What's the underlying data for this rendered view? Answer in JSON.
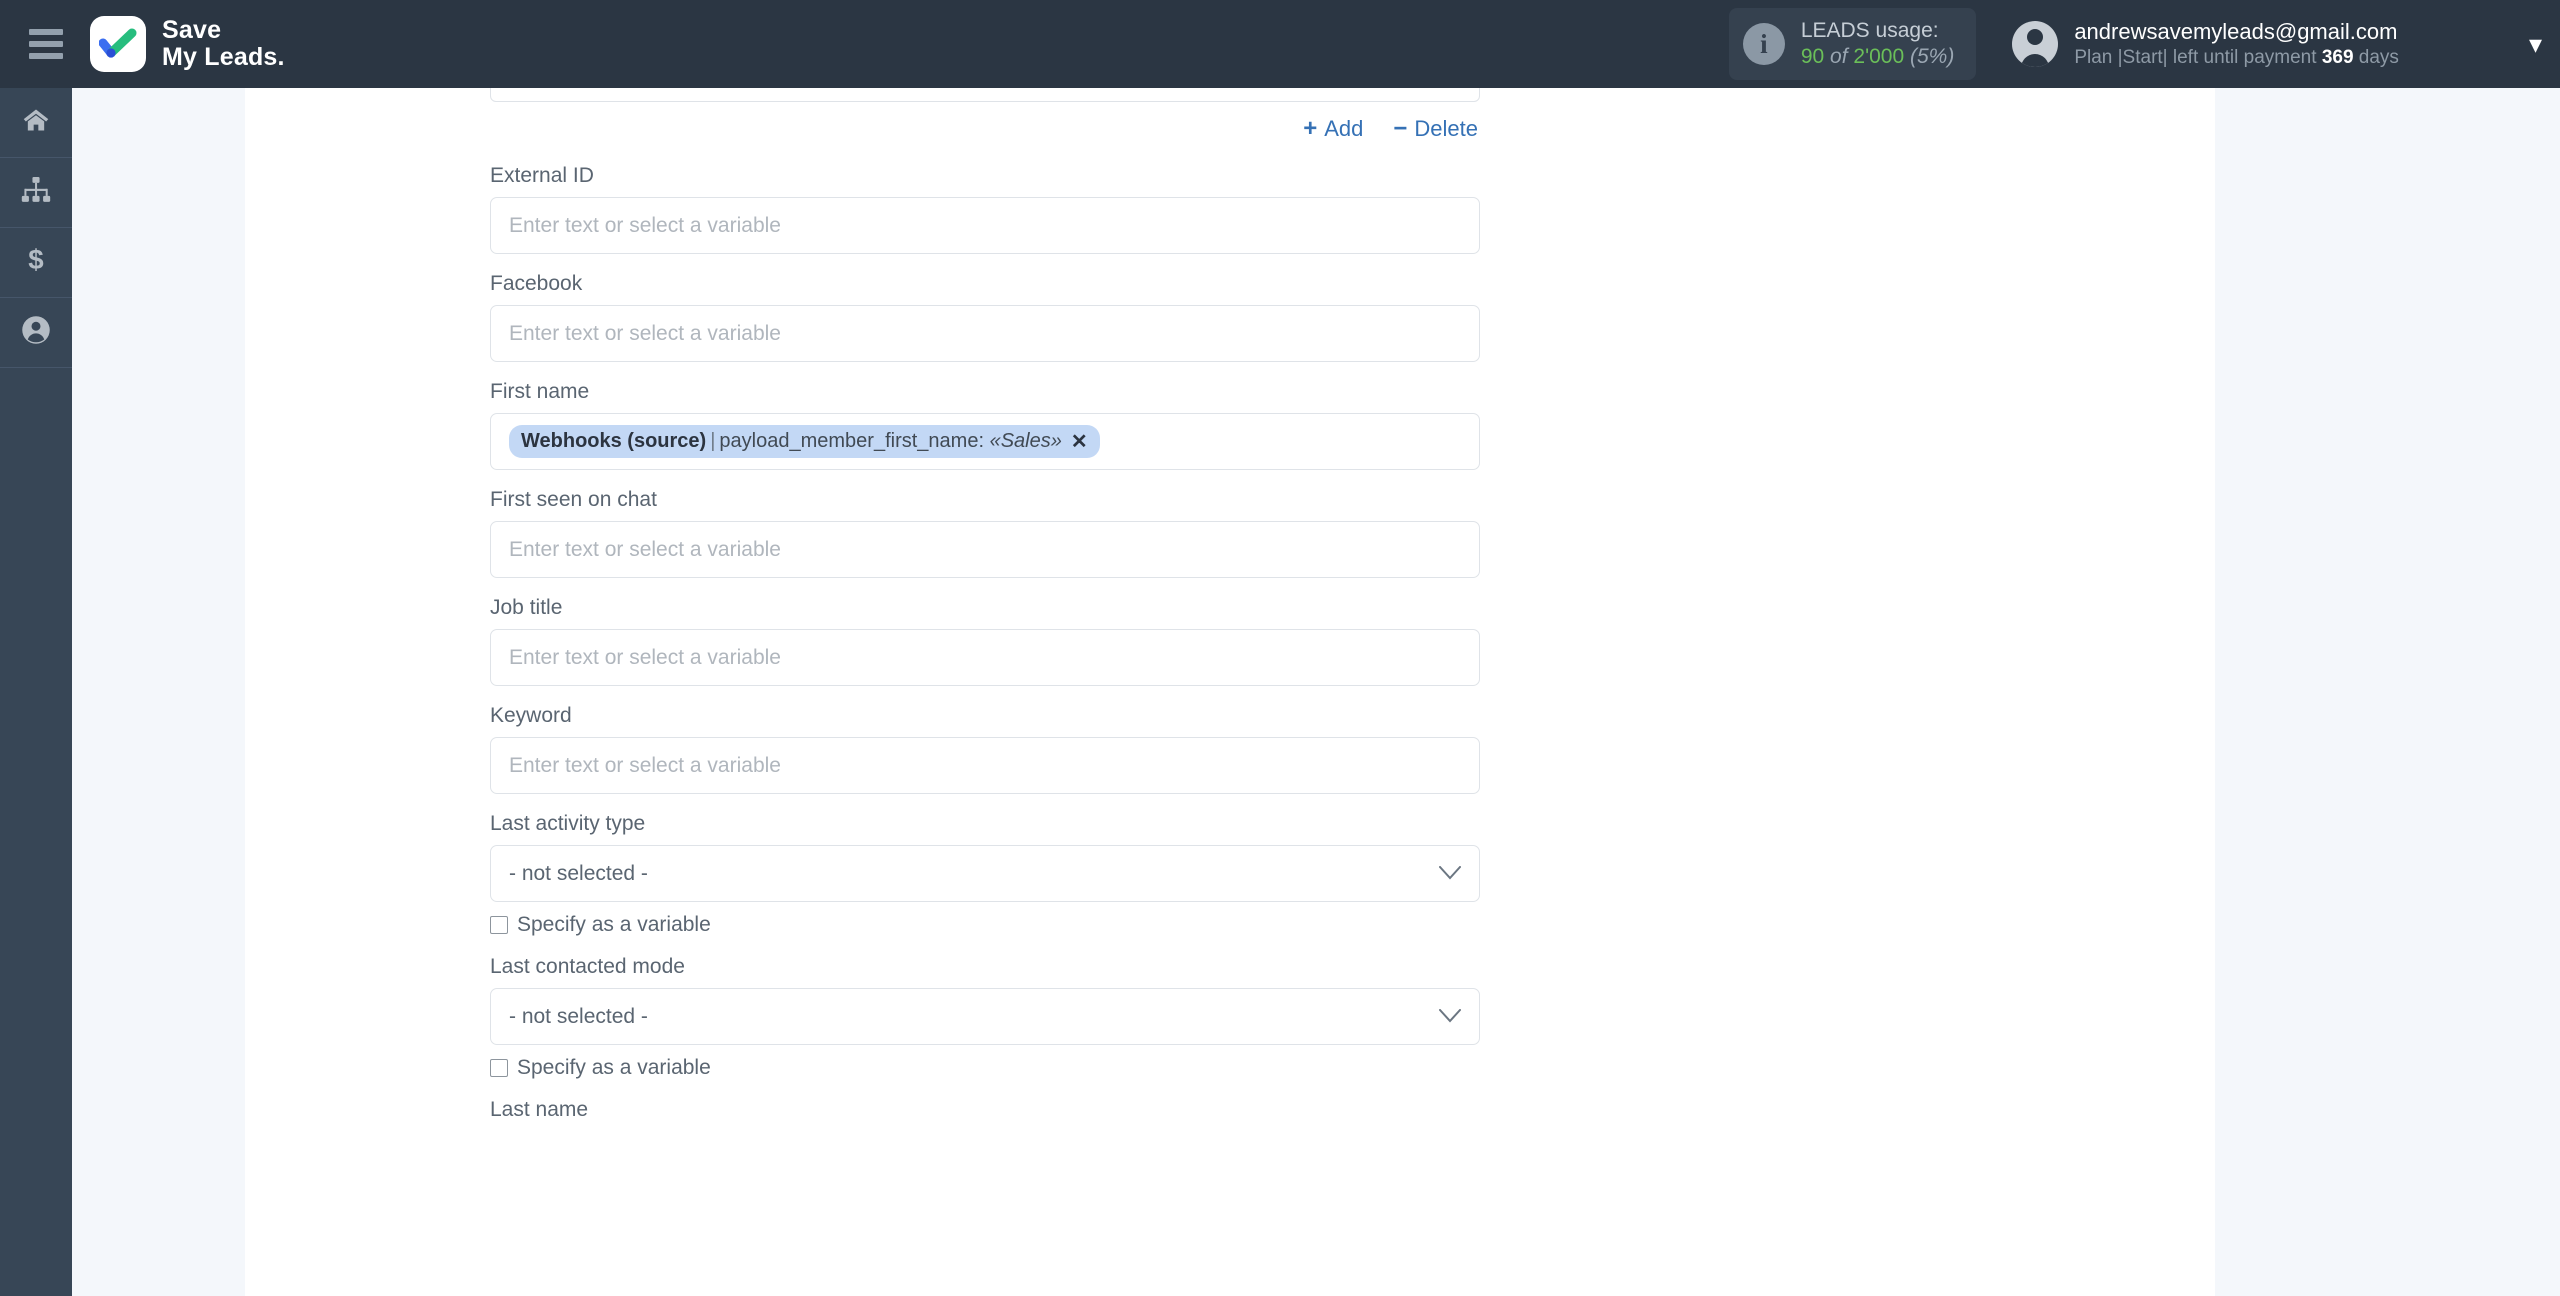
{
  "header": {
    "menu_icon": "hamburger-icon",
    "brand_line1": "Save",
    "brand_line2": "My Leads.",
    "usage": {
      "info_glyph": "i",
      "title": "LEADS usage:",
      "used": "90",
      "of": "of",
      "total": "2'000",
      "percent": "(5%)"
    },
    "account": {
      "email": "andrewsavemyleads@gmail.com",
      "plan_prefix": "Plan |Start| left until payment",
      "days_value": "369",
      "days_suffix": "days",
      "caret": "▾"
    }
  },
  "sidebar": {
    "items": [
      {
        "name": "home",
        "icon": "home-icon"
      },
      {
        "name": "connections",
        "icon": "sitemap-icon"
      },
      {
        "name": "billing",
        "icon": "dollar-icon"
      },
      {
        "name": "account",
        "icon": "user-circle-icon"
      }
    ]
  },
  "toolbar": {
    "add_symbol": "+",
    "add_label": "Add",
    "delete_symbol": "−",
    "delete_label": "Delete"
  },
  "form": {
    "placeholder": "Enter text or select a variable",
    "not_selected": "- not selected -",
    "specify_variable": "Specify as a variable",
    "chevron": "⌄",
    "chip": {
      "source": "Webhooks (source)",
      "separator": "|",
      "field": "payload_member_first_name:",
      "value": "«Sales»",
      "remove": "✕"
    },
    "fields": [
      {
        "label": "External ID",
        "type": "text"
      },
      {
        "label": "Facebook",
        "type": "text"
      },
      {
        "label": "First name",
        "type": "chip"
      },
      {
        "label": "First seen on chat",
        "type": "text"
      },
      {
        "label": "Job title",
        "type": "text"
      },
      {
        "label": "Keyword",
        "type": "text"
      },
      {
        "label": "Last activity type",
        "type": "select"
      },
      {
        "label": "Last contacted mode",
        "type": "select"
      },
      {
        "label": "Last name",
        "type": "label-only"
      }
    ]
  },
  "colors": {
    "header_bg": "#2b3643",
    "rail_bg": "#374656",
    "panel_bg": "#f4f7fb",
    "link_blue": "#3571b5",
    "chip_bg": "#c3d8f5",
    "usage_green": "#6bbf59"
  }
}
